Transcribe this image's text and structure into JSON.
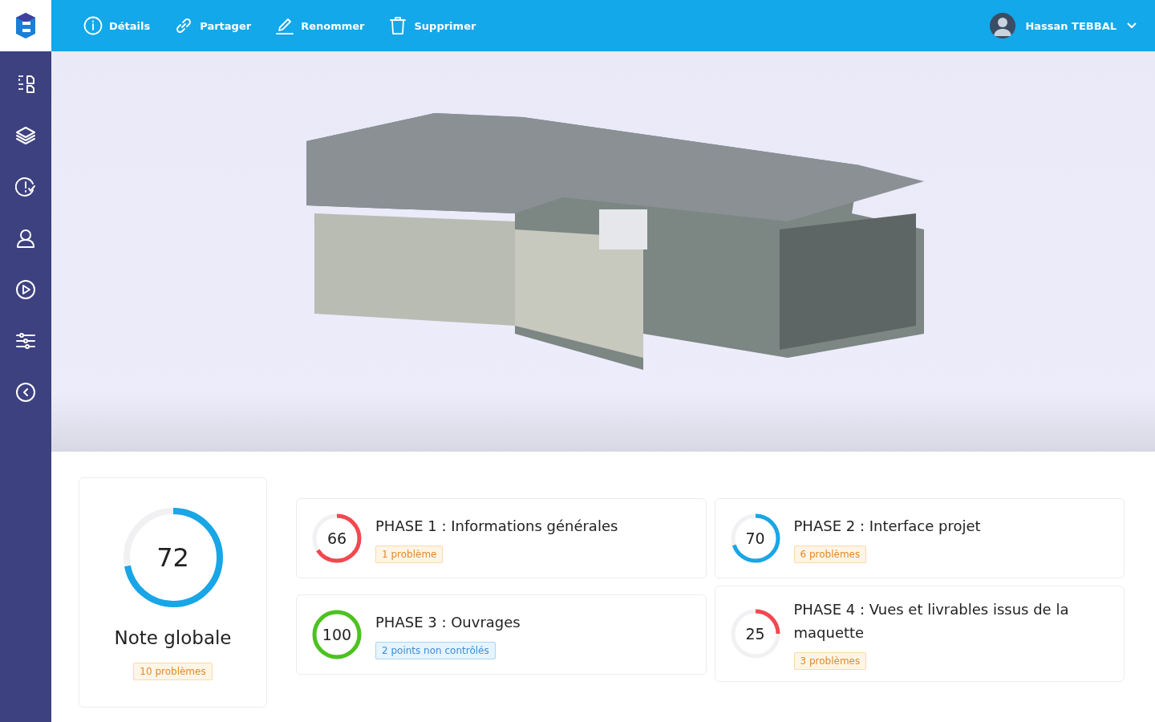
{
  "toolbar": {
    "actions": [
      {
        "kind": "info",
        "label": "Détails"
      },
      {
        "kind": "link",
        "label": "Partager"
      },
      {
        "kind": "edit",
        "label": "Renommer"
      },
      {
        "kind": "trash",
        "label": "Supprimer"
      }
    ],
    "user": {
      "name": "Hassan TEBBAL"
    }
  },
  "sidebar": {
    "items": [
      {
        "kind": "pages"
      },
      {
        "kind": "layers"
      },
      {
        "kind": "check"
      },
      {
        "kind": "user"
      },
      {
        "kind": "play"
      },
      {
        "kind": "sliders"
      },
      {
        "kind": "back"
      }
    ]
  },
  "global": {
    "score": "72",
    "level": 0.72,
    "color": "#18a6e6",
    "label": "Note globale",
    "badge": {
      "kind": "warning",
      "text": "10 problèmes"
    }
  },
  "phases": [
    {
      "score": "66",
      "level": 0.66,
      "color": "#f2484f",
      "title": "PHASE 1 : Informations générales",
      "badge": {
        "kind": "warning",
        "text": "1 problème"
      }
    },
    {
      "score": "100",
      "level": 1,
      "color": "#4cc21f",
      "title": "PHASE 3 : Ouvrages",
      "badge": {
        "kind": "info",
        "text": "2 points non contrôlés"
      }
    },
    {
      "score": "70",
      "level": 0.7,
      "color": "#18a6e6",
      "title": "PHASE 2 : Interface projet",
      "badge": {
        "kind": "warning",
        "text": "6 problèmes"
      }
    },
    {
      "score": "25",
      "level": 0.25,
      "color": "#f2484f",
      "title": "PHASE 4 : Vues et livrables issus de la maquette",
      "badge": {
        "kind": "warning",
        "text": "3 problèmes"
      }
    }
  ]
}
